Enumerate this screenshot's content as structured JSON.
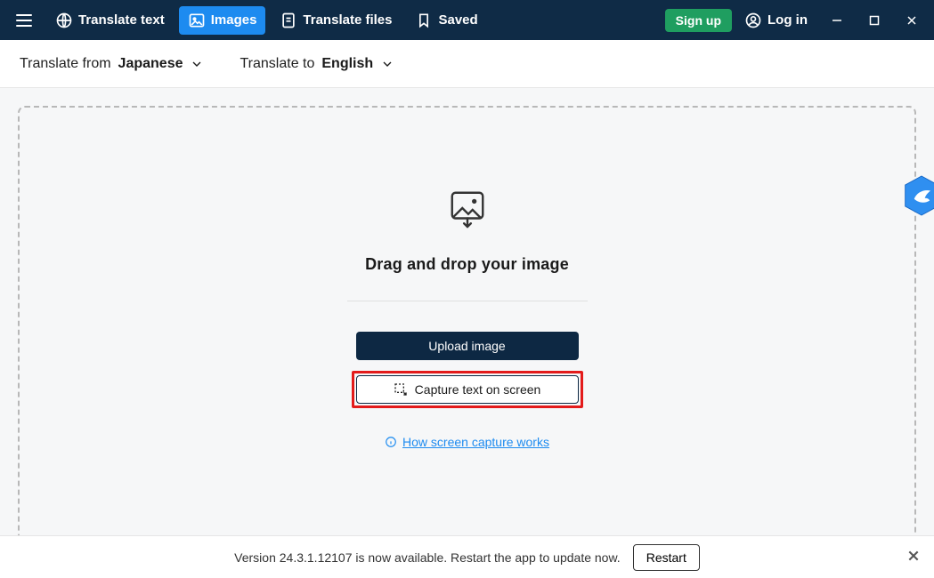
{
  "nav": {
    "translate_text": "Translate text",
    "images": "Images",
    "translate_files": "Translate files",
    "saved": "Saved"
  },
  "auth": {
    "signup": "Sign up",
    "login": "Log in"
  },
  "lang": {
    "from_label": "Translate from",
    "from_value": "Japanese",
    "to_label": "Translate to",
    "to_value": "English"
  },
  "drop": {
    "title": "Drag and drop your image",
    "upload": "Upload image",
    "capture": "Capture text on screen",
    "howlink": "How screen capture works"
  },
  "update": {
    "message": "Version 24.3.1.12107 is now available. Restart the app to update now.",
    "restart": "Restart"
  }
}
